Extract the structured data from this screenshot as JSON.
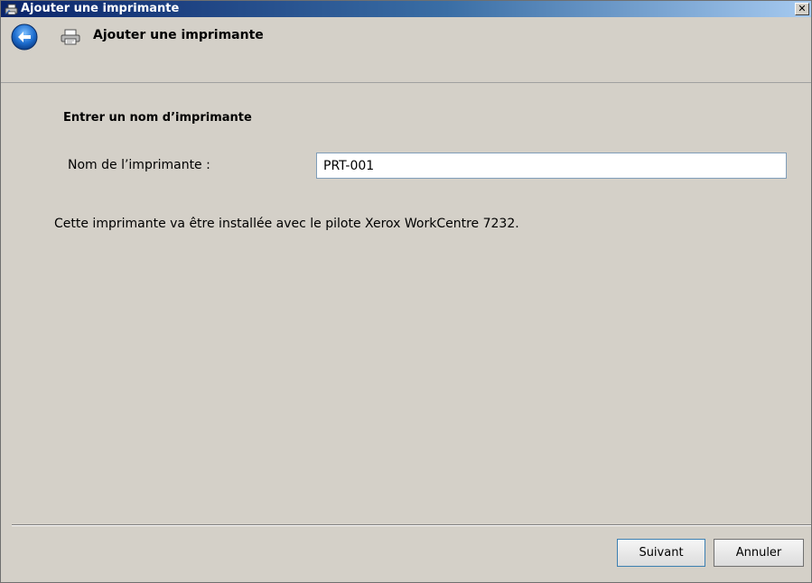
{
  "window": {
    "title": "Ajouter une imprimante",
    "close_label": "✕"
  },
  "nav": {
    "title": "Ajouter une imprimante",
    "back_icon": "back-arrow-icon",
    "printer_icon": "printer-icon"
  },
  "main": {
    "heading": "Entrer un nom d’imprimante",
    "name_label": "Nom de l’imprimante :",
    "name_value": "PRT-001",
    "info": "Cette imprimante va être installée avec le pilote Xerox WorkCentre 7232."
  },
  "footer": {
    "next_label": "Suivant",
    "cancel_label": "Annuler"
  },
  "colors": {
    "titlebar_start": "#0a246a",
    "titlebar_end": "#a6caf0",
    "dialog_bg": "#d4d0c8",
    "back_button": "#1f6fd0"
  }
}
